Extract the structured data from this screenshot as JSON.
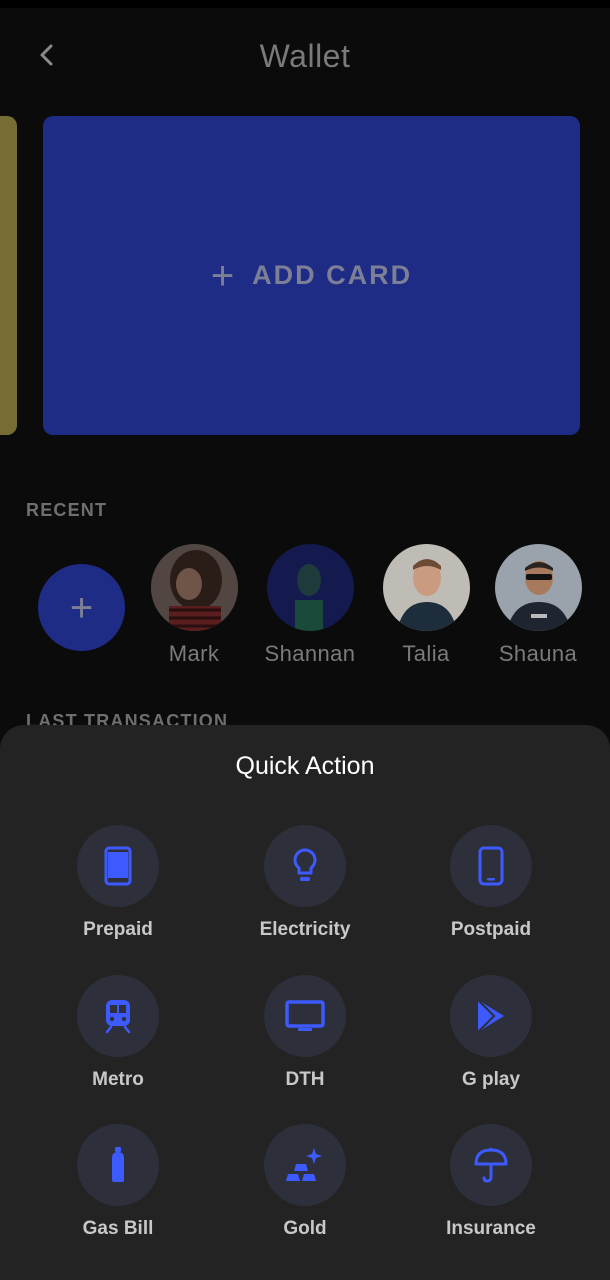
{
  "header": {
    "title": "Wallet"
  },
  "cards": {
    "add_card_plus": "+",
    "add_card_label": "ADD CARD"
  },
  "recent": {
    "title": "RECENT",
    "add_plus": "+",
    "contacts": [
      {
        "name": "Mark"
      },
      {
        "name": "Shannan"
      },
      {
        "name": "Talia"
      },
      {
        "name": "Shauna"
      }
    ]
  },
  "last_transaction": {
    "title": "LAST TRANSACTION"
  },
  "quick_action": {
    "title": "Quick Action",
    "items": [
      {
        "label": "Prepaid",
        "icon": "smartphone-icon"
      },
      {
        "label": "Electricity",
        "icon": "lightbulb-icon"
      },
      {
        "label": "Postpaid",
        "icon": "mobile-phone-icon"
      },
      {
        "label": "Metro",
        "icon": "train-icon"
      },
      {
        "label": "DTH",
        "icon": "tv-icon"
      },
      {
        "label": "G play",
        "icon": "google-play-icon"
      },
      {
        "label": "Gas Bill",
        "icon": "gas-cylinder-icon"
      },
      {
        "label": "Gold",
        "icon": "gold-bars-icon"
      },
      {
        "label": "Insurance",
        "icon": "umbrella-icon"
      }
    ]
  },
  "colors": {
    "accent": "#3d5afe",
    "card_blue": "#1e2c85",
    "sheet": "#232323",
    "background": "#0b0b0b"
  }
}
